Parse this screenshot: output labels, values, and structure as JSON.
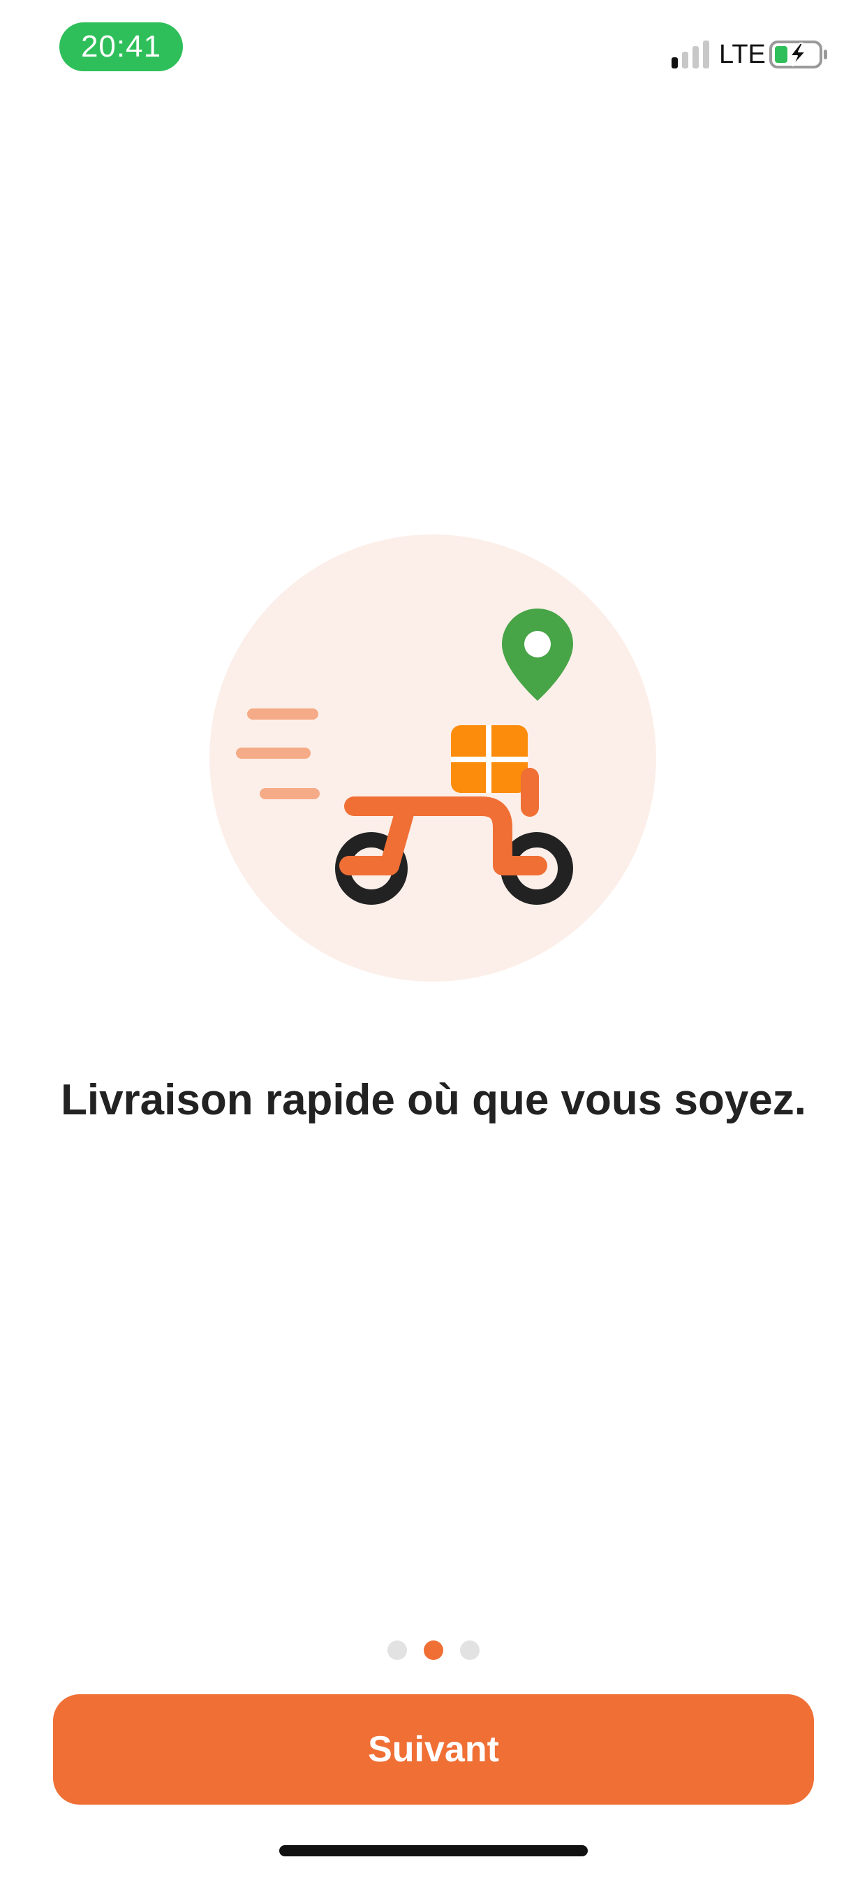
{
  "status_bar": {
    "time": "20:41",
    "network": "LTE",
    "icons": [
      "signal-icon",
      "battery-charging-icon"
    ]
  },
  "illustration": {
    "icons": [
      "delivery-scooter-icon",
      "location-pin-icon",
      "package-icon",
      "speed-lines-icon"
    ]
  },
  "onboarding": {
    "headline": "Livraison rapide où que vous soyez.",
    "page_count": 3,
    "current_page": 2
  },
  "actions": {
    "next_label": "Suivant"
  },
  "colors": {
    "accent": "#f06f35",
    "status_green": "#2fbf5a",
    "pin_green": "#47a447",
    "package_orange": "#fb8c0c",
    "circle_bg": "#fcefe9"
  }
}
